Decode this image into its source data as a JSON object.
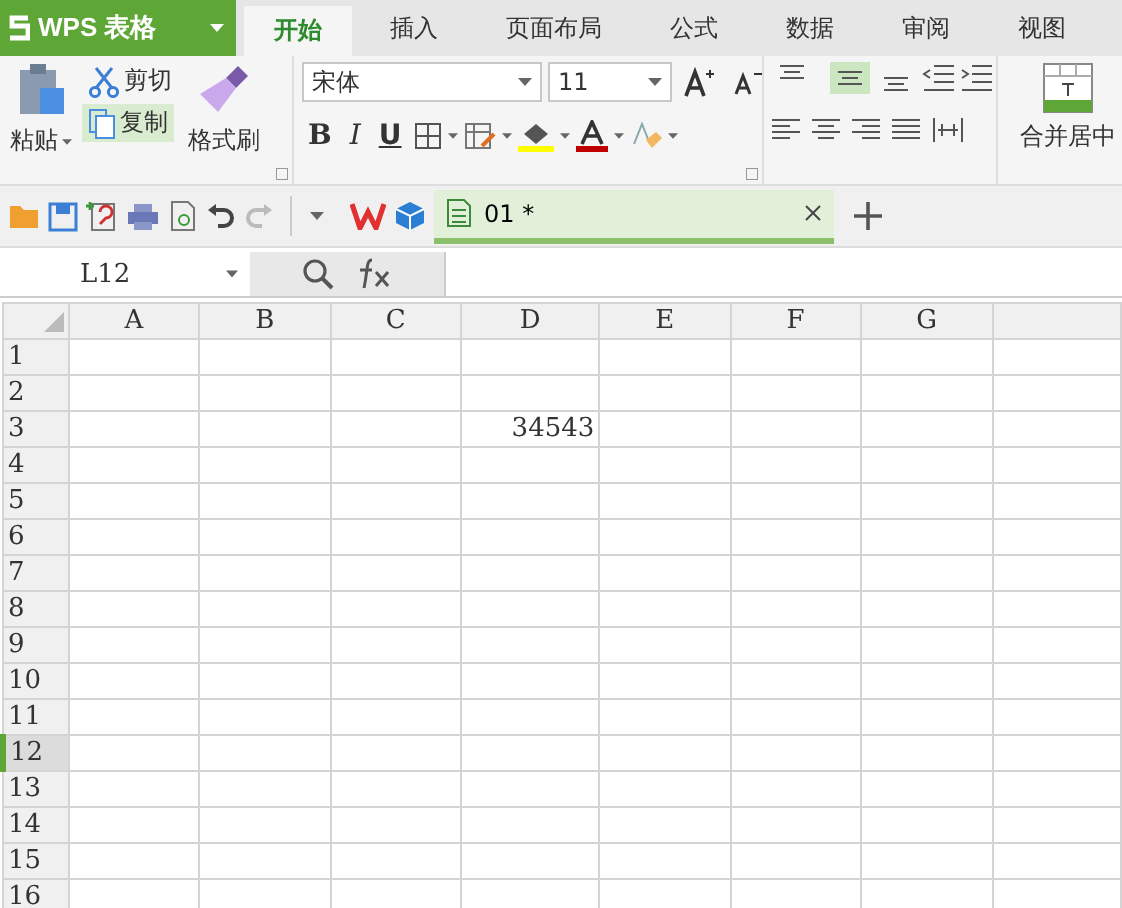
{
  "app_menu": {
    "label": "WPS 表格"
  },
  "tabs": [
    {
      "label": "开始",
      "selected": true
    },
    {
      "label": "插入",
      "selected": false
    },
    {
      "label": "页面布局",
      "selected": false
    },
    {
      "label": "公式",
      "selected": false
    },
    {
      "label": "数据",
      "selected": false
    },
    {
      "label": "审阅",
      "selected": false
    },
    {
      "label": "视图",
      "selected": false
    }
  ],
  "ribbon": {
    "paste": "粘贴",
    "cut": "剪切",
    "copy": {
      "label": "复制",
      "highlighted": true
    },
    "format_painter": "格式刷",
    "font_name": "宋体",
    "font_size": "11",
    "bold": "B",
    "italic": "I",
    "underline": "U",
    "align_top": [
      {
        "kind": "top",
        "selected": false
      },
      {
        "kind": "middle",
        "selected": true
      },
      {
        "kind": "bottom",
        "selected": false
      }
    ],
    "merge": "合并居中"
  },
  "doc_tabs": [
    {
      "label": "01 *",
      "selected": true
    }
  ],
  "name_box": "L12",
  "columns": [
    "A",
    "B",
    "C",
    "D",
    "E",
    "F",
    "G"
  ],
  "rows": [
    {
      "label": "1",
      "selected": false
    },
    {
      "label": "2",
      "selected": false
    },
    {
      "label": "3",
      "selected": false,
      "cells": [
        null,
        null,
        null,
        "34543",
        null,
        null,
        null
      ]
    },
    {
      "label": "4",
      "selected": false
    },
    {
      "label": "5",
      "selected": false
    },
    {
      "label": "6",
      "selected": false
    },
    {
      "label": "7",
      "selected": false
    },
    {
      "label": "8",
      "selected": false
    },
    {
      "label": "9",
      "selected": false
    },
    {
      "label": "10",
      "selected": false
    },
    {
      "label": "11",
      "selected": false
    },
    {
      "label": "12",
      "selected": true
    },
    {
      "label": "13",
      "selected": false
    },
    {
      "label": "14",
      "selected": false
    },
    {
      "label": "15",
      "selected": false
    },
    {
      "label": "16",
      "selected": false
    }
  ]
}
